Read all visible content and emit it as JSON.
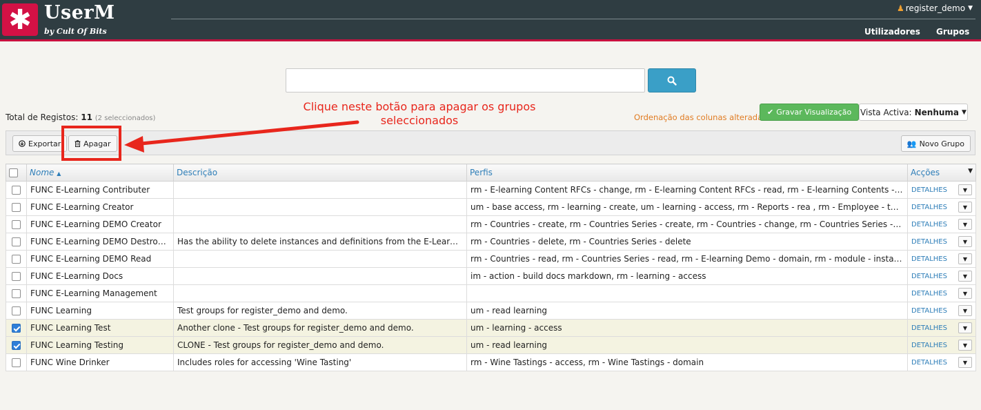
{
  "header": {
    "logo_glyph": "✱",
    "brand_title": "UserM",
    "brand_subtitle": "by Cult Of Bits",
    "user_name": "register_demo",
    "nav": {
      "users": "Utilizadores",
      "groups": "Grupos"
    }
  },
  "search": {
    "value": "",
    "placeholder": ""
  },
  "info": {
    "total_label": "Total de Registos:",
    "total_count": "11",
    "selected_text": "(2 seleccionados)",
    "order_msg": "Ordenação das colunas alterada",
    "save_view_label": "Gravar Visualização",
    "active_view_label": "Vista Activa:",
    "active_view_value": "Nenhuma"
  },
  "annotation": {
    "line1": "Clique neste botão para apagar os grupos",
    "line2": "seleccionados",
    "color": "#e8261c"
  },
  "toolbar": {
    "export_label": "Exportar",
    "delete_label": "Apagar",
    "new_group_label": "Novo Grupo"
  },
  "table": {
    "columns": {
      "name": "Nome",
      "description": "Descrição",
      "profiles": "Perfis",
      "actions": "Acções"
    },
    "details_label": "DETALHES",
    "rows": [
      {
        "checked": false,
        "name": "FUNC E-Learning Contributer",
        "description": "",
        "profiles": "rm - E-learning Content RFCs - change, rm - E-learning Content RFCs - read, rm - E-learning Contents - domain, R..."
      },
      {
        "checked": false,
        "name": "FUNC E-Learning Creator",
        "description": "",
        "profiles": "um - base access, rm - learning - create, um - learning - access, rm - Reports - rea  , rm - Employee - tasks"
      },
      {
        "checked": false,
        "name": "FUNC E-Learning DEMO Creator",
        "description": "",
        "profiles": "rm - Countries - create, rm - Countries Series - create, rm - Countries - change, rm - Countries Series - change, rm..."
      },
      {
        "checked": false,
        "name": "FUNC E-Learning DEMO Destroyer",
        "description": "Has the ability to delete instances and definitions from the E-Learning De...",
        "profiles": "rm - Countries - delete, rm - Countries Series - delete"
      },
      {
        "checked": false,
        "name": "FUNC E-Learning DEMO Read",
        "description": "",
        "profiles": "rm - Countries - read, rm - Countries Series - read, rm - E-learning Demo - domain, rm - module - instance details,..."
      },
      {
        "checked": false,
        "name": "FUNC E-Learning Docs",
        "description": "",
        "profiles": "im - action - build docs markdown, rm - learning - access"
      },
      {
        "checked": false,
        "name": "FUNC E-Learning Management",
        "description": "",
        "profiles": ""
      },
      {
        "checked": false,
        "name": "FUNC Learning",
        "description": "Test groups for register_demo and demo.",
        "profiles": "um - read learning"
      },
      {
        "checked": true,
        "name": "FUNC Learning Test",
        "description": "Another clone - Test groups for register_demo and demo.",
        "profiles": "um - learning - access"
      },
      {
        "checked": true,
        "name": "FUNC Learning Testing",
        "description": "CLONE - Test groups for register_demo and demo.",
        "profiles": "um - read learning"
      },
      {
        "checked": false,
        "name": "FUNC Wine Drinker",
        "description": "Includes roles for accessing 'Wine Tasting'",
        "profiles": "rm - Wine Tastings - access, rm - Wine Tastings - domain"
      }
    ]
  }
}
